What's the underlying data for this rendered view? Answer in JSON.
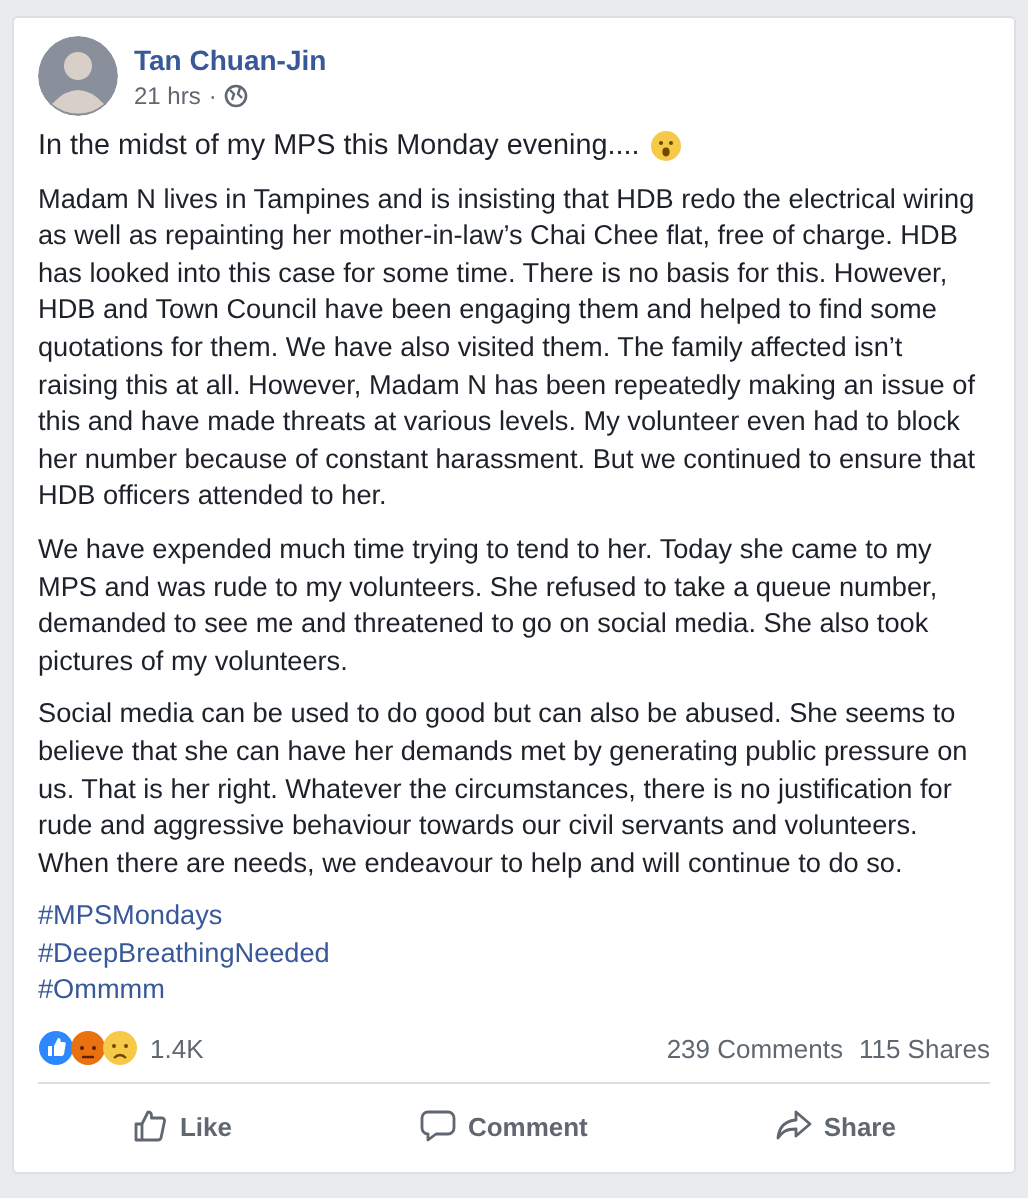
{
  "post": {
    "author": "Tan Chuan-Jin",
    "time": "21 hrs",
    "separator": "·",
    "intro": "In the midst of my MPS this Monday evening....",
    "paragraphs": [
      "Madam N lives in Tampines and is insisting that HDB redo the electrical wiring as well as repainting her mother-in-law’s Chai Chee flat, free of charge. HDB has looked into this case for some time. There is no basis for this. However, HDB and Town Council have been engaging them and helped to find some quotations for them. We have also visited them. The family affected isn’t raising this at all. However, Madam N has been repeatedly making an issue of this and have made threats at various levels. My volunteer even had to block her number because of constant harassment. But we continued to ensure that HDB officers attended to her.",
      "We have expended much time trying to tend to her. Today she came to my MPS and was rude to my volunteers. She refused to take a queue number, demanded to see me and threatened to go on social media. She also took pictures of my volunteers.",
      "Social media can be used to do good but can also be abused. She seems to believe that she can have her demands met by generating public pressure on us. That is her right. Whatever the circumstances, there is no justification for rude and aggressive behaviour towards our civil servants and volunteers. When there are needs, we endeavour to help and will continue to do so."
    ],
    "hashtags": [
      "#MPSMondays",
      "#DeepBreathingNeeded",
      "#Ommmm"
    ],
    "reactions_count": "1.4K",
    "comments_count": "239 Comments",
    "shares_count": "115 Shares",
    "actions": [
      {
        "kind": "like",
        "label": "Like"
      },
      {
        "kind": "comment",
        "label": "Comment"
      },
      {
        "kind": "share",
        "label": "Share"
      }
    ]
  }
}
